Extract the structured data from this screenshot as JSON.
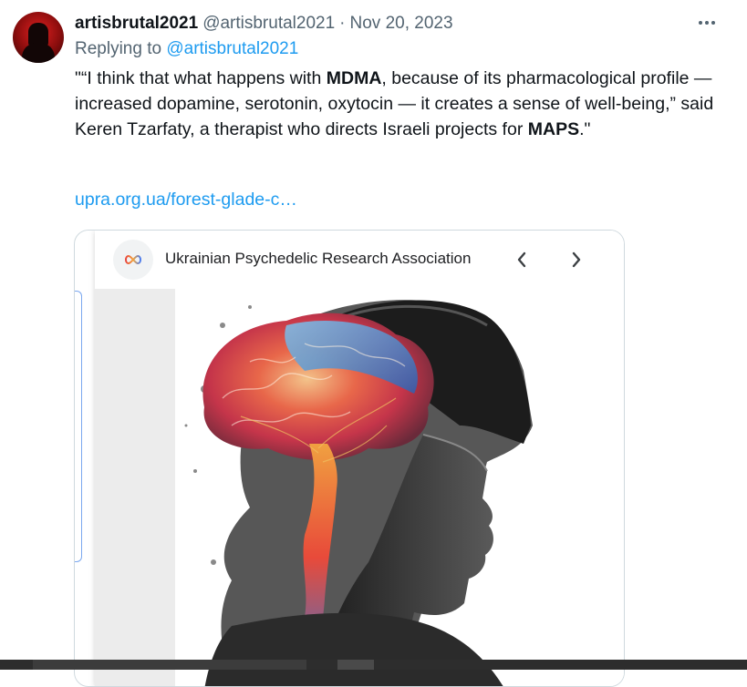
{
  "tweet": {
    "author_name": "artisbrutal2021",
    "author_handle": "@artisbrutal2021",
    "separator": "·",
    "date": "Nov 20, 2023",
    "reply_prefix": "Replying to",
    "reply_handle": "@artisbrutal2021",
    "text": {
      "part1": "\"“I think that what happens with ",
      "bold1": "MDMA",
      "part2": ", because of its pharmacological profile — increased dopamine, serotonin, oxytocin — it creates a sense  of well-being,” said Keren Tzarfaty, a therapist who directs Israeli  projects for ",
      "bold2": "MAPS",
      "part3": ".\""
    },
    "link": "upra.org.ua/forest-glade-c…"
  },
  "card": {
    "site_name": "Ukrainian Psychedelic Research Association",
    "site_icon": "infinity-logo-icon",
    "prev_icon": "chevron-left-icon",
    "next_icon": "chevron-right-icon",
    "image": "soldier-profile-with-colorful-brain-illustration"
  },
  "colors": {
    "accent_link": "#1d9bf0",
    "text_primary": "#0f1419",
    "text_secondary": "#536471"
  }
}
